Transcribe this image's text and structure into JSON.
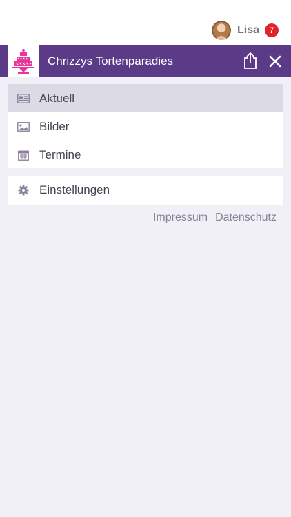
{
  "user": {
    "name": "Lisa",
    "notification_count": "7"
  },
  "header": {
    "title": "Chrizzys Tortenparadies",
    "accent_color": "#5b3b87",
    "logo_color": "#e8379c"
  },
  "menu": {
    "items": [
      {
        "label": "Aktuell",
        "icon": "news-icon",
        "active": true
      },
      {
        "label": "Bilder",
        "icon": "image-icon",
        "active": false
      },
      {
        "label": "Termine",
        "icon": "calendar-icon",
        "active": false
      }
    ],
    "settings": {
      "label": "Einstellungen",
      "icon": "gear-icon"
    }
  },
  "footer": {
    "impressum": "Impressum",
    "datenschutz": "Datenschutz"
  }
}
